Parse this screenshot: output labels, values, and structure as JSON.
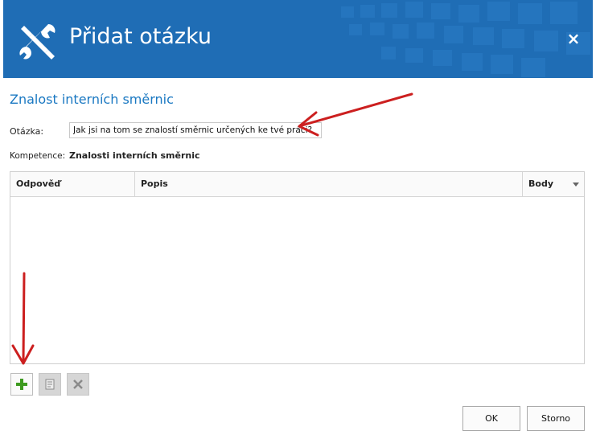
{
  "dialog": {
    "title": "Přidat otázku",
    "close_symbol": "×",
    "header_color": "#1f6db5"
  },
  "section_title": "Znalost interních směrnic",
  "question": {
    "label": "Otázka:",
    "value": "Jak jsi na tom se znalostí směrnic určených ke tvé práci?"
  },
  "competence": {
    "label": "Kompetence:",
    "value": "Znalosti interních směrnic"
  },
  "grid": {
    "columns": [
      {
        "label": "Odpověď"
      },
      {
        "label": "Popis"
      },
      {
        "label": "Body"
      }
    ],
    "rows": []
  },
  "toolbar": {
    "add_icon": "plus-icon",
    "edit_icon": "edit-icon",
    "delete_icon": "delete-icon"
  },
  "buttons": {
    "ok_label": "OK",
    "cancel_label": "Storno"
  },
  "annotation_color": "#cc1f1f"
}
